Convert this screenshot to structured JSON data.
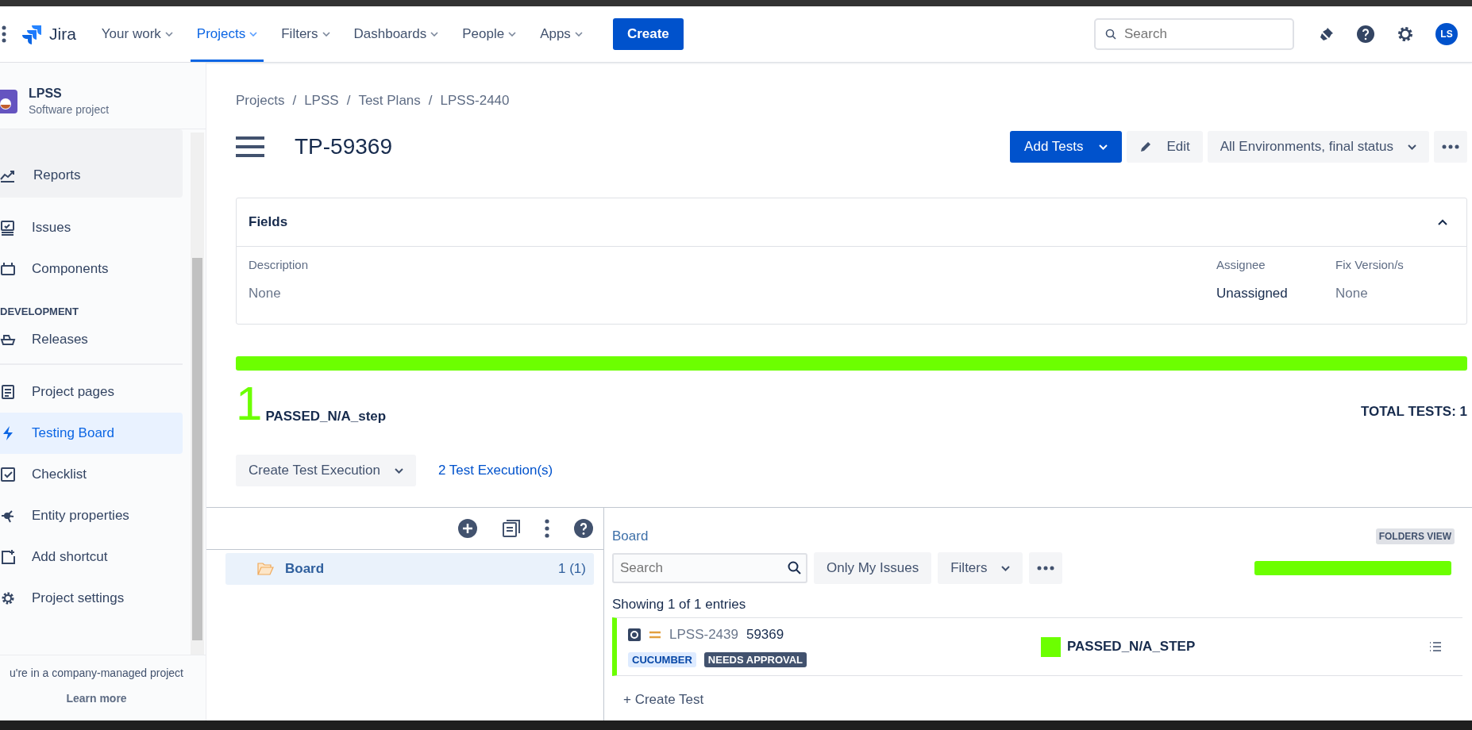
{
  "nav": {
    "logo": "Jira",
    "items": [
      {
        "label": "Your work",
        "selected": false
      },
      {
        "label": "Projects",
        "selected": true
      },
      {
        "label": "Filters",
        "selected": false
      },
      {
        "label": "Dashboards",
        "selected": false
      },
      {
        "label": "People",
        "selected": false
      },
      {
        "label": "Apps",
        "selected": false
      }
    ],
    "create": "Create",
    "search": {
      "placeholder": "Search"
    },
    "avatar": "LS"
  },
  "sidebar": {
    "project": {
      "name": "LPSS",
      "type": "Software project"
    },
    "items": [
      {
        "kind": "item",
        "label": "Reports",
        "selected": false
      },
      {
        "kind": "item",
        "label": "Issues",
        "selected": false
      },
      {
        "kind": "item",
        "label": "Components",
        "selected": false
      },
      {
        "kind": "heading",
        "label": "DEVELOPMENT"
      },
      {
        "kind": "item",
        "label": "Releases",
        "selected": false
      },
      {
        "kind": "divider"
      },
      {
        "kind": "item",
        "label": "Project pages",
        "selected": false
      },
      {
        "kind": "item",
        "label": "Testing Board",
        "selected": true
      },
      {
        "kind": "item",
        "label": "Checklist",
        "selected": false
      },
      {
        "kind": "item",
        "label": "Entity properties",
        "selected": false
      },
      {
        "kind": "item",
        "label": "Add shortcut",
        "selected": false
      },
      {
        "kind": "item",
        "label": "Project settings",
        "selected": false
      }
    ],
    "footer": "u're in a company-managed project",
    "learn_more": "Learn more"
  },
  "breadcrumbs": [
    "Projects",
    "LPSS",
    "Test Plans",
    "LPSS-2440"
  ],
  "breadcrumb_separator": "/",
  "title": "TP-59369",
  "actions": {
    "add_tests": "Add Tests",
    "edit": "Edit",
    "environment": "All Environments, final status"
  },
  "fields": {
    "title": "Fields",
    "expanded": true,
    "columns": [
      {
        "label": "Description",
        "value": "None"
      },
      {
        "label": "Assignee",
        "value": "Unassigned"
      },
      {
        "label": "Fix Version/s",
        "value": "None"
      }
    ]
  },
  "summary": {
    "progress": {
      "level": 1,
      "color": "#6cff00"
    },
    "count": "1",
    "status": "PASSED_N/A_step",
    "total": "TOTAL TESTS: 1"
  },
  "executions": {
    "create": "Create Test Execution",
    "link": "2 Test Execution(s)"
  },
  "folders": [
    {
      "name": "Board",
      "count": "1 (1)",
      "selected": true
    }
  ],
  "board": {
    "title": "Board",
    "view": "FOLDERS VIEW",
    "search": {
      "placeholder": "Search"
    },
    "only_mine": "Only My Issues",
    "filters": "Filters",
    "progress": {
      "level": 1,
      "color": "#6cff00"
    },
    "showing": "Showing 1 of 1 entries",
    "tests": [
      {
        "key": "LPSS-2439",
        "summary": "59369",
        "color": "#6cff00",
        "status": "PASSED_N/A_STEP",
        "labels": [
          {
            "text": "CUCUMBER",
            "kind": "light"
          },
          {
            "text": "NEEDS APPROVAL",
            "kind": "dark"
          }
        ]
      }
    ],
    "create": "+ Create Test"
  }
}
